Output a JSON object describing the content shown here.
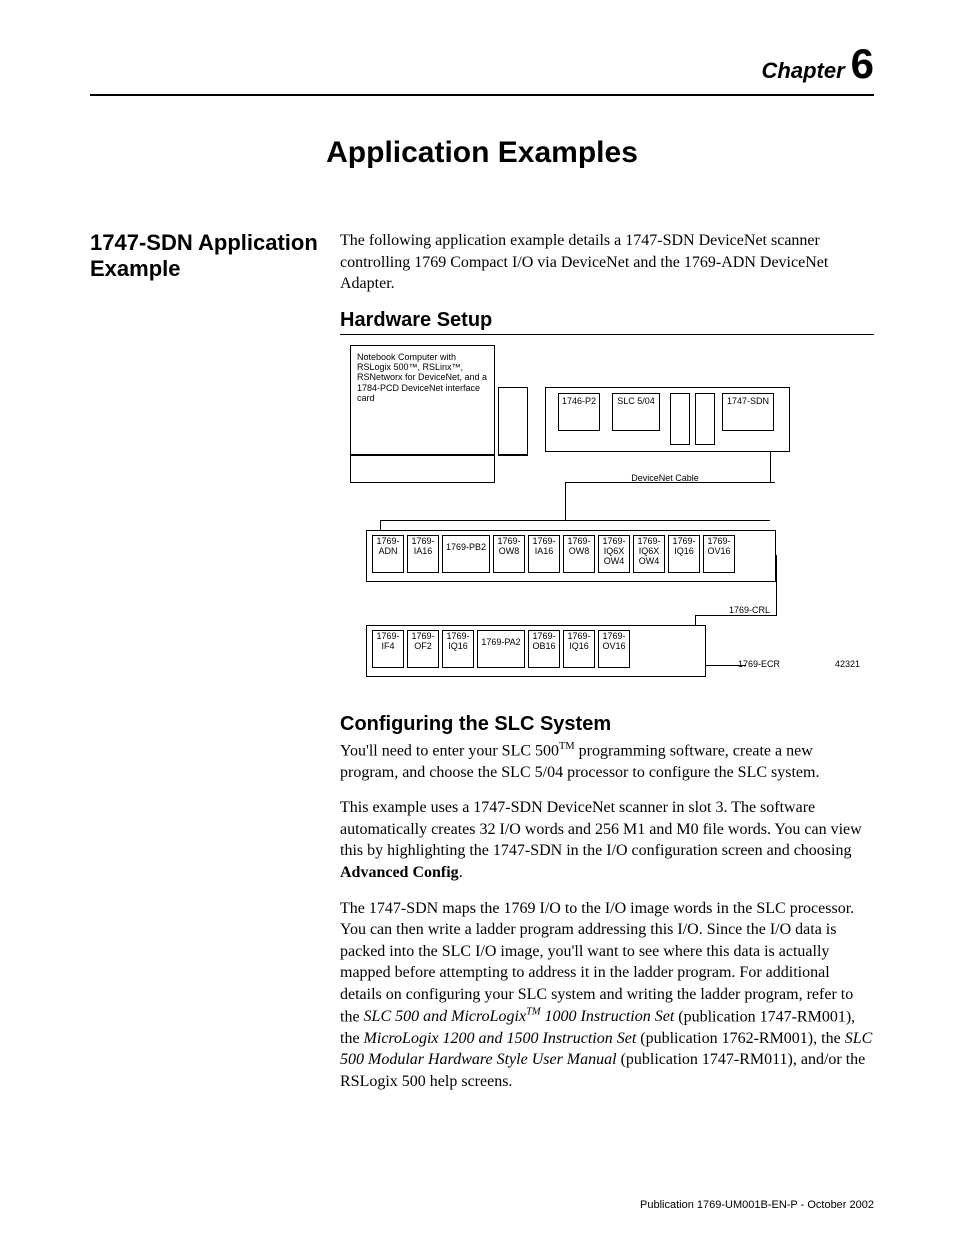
{
  "chapter": {
    "word": "Chapter",
    "number": "6"
  },
  "title": "Application Examples",
  "side_heading": "1747-SDN Application Example",
  "intro": "The following application example details a 1747-SDN DeviceNet scanner controlling 1769 Compact I/O via DeviceNet and the 1769-ADN DeviceNet Adapter.",
  "hardware_heading": "Hardware Setup",
  "diagram": {
    "notebook": "Notebook Computer with RSLogix 500™, RSLinx™, RSNetworx for DeviceNet, and a 1784-PCD DeviceNet interface card",
    "top_modules": [
      "1746-P2",
      "SLC 5/04",
      "1747-SDN"
    ],
    "cable_label": "DeviceNet Cable",
    "row1": [
      "1769-\nADN",
      "1769-\nIA16",
      "1769-PB2",
      "1769-\nOW8",
      "1769-\nIA16",
      "1769-\nOW8",
      "1769-\nIQ6X\nOW4",
      "1769-\nIQ6X\nOW4",
      "1769-\nIQ16",
      "1769-\nOV16"
    ],
    "row2": [
      "1769-\nIF4",
      "1769-\nOF2",
      "1769-\nIQ16",
      "1769-PA2",
      "1769-\nOB16",
      "1769-\nIQ16",
      "1769-\nOV16"
    ],
    "crl": "1769-CRL",
    "ecr": "1769-ECR",
    "fig_id": "42321"
  },
  "config_heading": "Configuring the SLC System",
  "p1_a": "You'll need to enter your SLC 500",
  "p1_tm": "TM",
  "p1_b": " programming software, create a new program, and choose the SLC 5/04 processor to configure the SLC system.",
  "p2_a": "This example uses a 1747-SDN DeviceNet scanner in slot 3. The software automatically creates 32 I/O words and 256 M1 and M0 file words. You can view this by highlighting the 1747-SDN in the I/O configuration screen and choosing ",
  "p2_bold": "Advanced Config",
  "p2_b": ".",
  "p3_a": "The 1747-SDN maps the 1769 I/O to the I/O image words in the SLC processor. You can then write a ladder program addressing this I/O. Since the I/O data is packed into the SLC I/O image, you'll want to see where this data is actually mapped before attempting to address it in the ladder program. For additional details on configuring your SLC system and writing the ladder program, refer to the ",
  "p3_it1a": "SLC 500 and MicroLogix",
  "p3_it1_tm": "TM",
  "p3_it1b": " 1000 Instruction Set",
  "p3_b": " (publication 1747-RM001), the ",
  "p3_it2": "MicroLogix 1200 and 1500 Instruction Set",
  "p3_c": " (publication 1762-RM001), the ",
  "p3_it3": "SLC 500 Modular Hardware Style User Manual",
  "p3_d": " (publication 1747-RM011), and/or the RSLogix 500 help screens.",
  "footer": "Publication 1769-UM001B-EN-P - October 2002"
}
